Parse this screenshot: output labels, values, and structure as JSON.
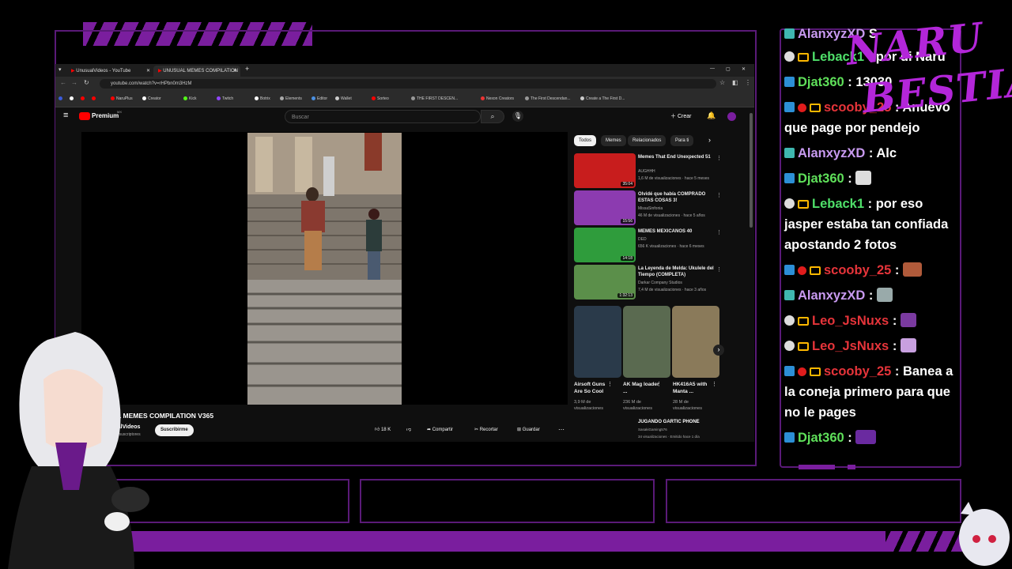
{
  "browser": {
    "tabs": [
      {
        "label": "UnusualVideos - YouTube"
      },
      {
        "label": "UNUSUAL MEMES COMPILATION"
      }
    ],
    "new_tab": "+",
    "url": "youtube.com/watch?v=rHPbn0m3HzM",
    "bookmarks": [
      "NaruPlus",
      "Creator",
      "Kick",
      "Twitch",
      "Botrix",
      "Elements",
      "Editor",
      "Wallet",
      "Sorteo",
      "THE FIRST DESCEN...",
      "Nexon Creators",
      "The First Descendan...",
      "Create a The First D..."
    ]
  },
  "youtube": {
    "logo_text": "Premium",
    "logo_sup": "MX",
    "search_placeholder": "Buscar",
    "create_label": "Crear",
    "video_title": "USUAL MEMES COMPILATION V365",
    "channel_name": "UnusualVideos",
    "subscribers": "3,71 M de suscriptores",
    "subscribe_label": "Suscribirme",
    "likes": "18 K",
    "share_label": "Compartir",
    "clip_label": "Recortar",
    "save_label": "Guardar",
    "chips": [
      "Todos",
      "Memes",
      "Relacionados",
      "Para ti"
    ],
    "recommendations": [
      {
        "title": "Memes That End Unexpected 51",
        "channel": "AUGHHH",
        "stats": "1,6 M de visualizaciones · hace 5 meses",
        "duration": "35:04",
        "color": "#c81d1d"
      },
      {
        "title": "Olvidé que había COMPRADO ESTAS COSAS 3!",
        "channel": "MissaSinfonia",
        "stats": "46 M de visualizaciones · hace 5 años",
        "duration": "15:56",
        "color": "#8c3bb0"
      },
      {
        "title": "MEMES MEXICANOS 40",
        "channel": "DED",
        "stats": "656 K visualizaciones · hace 6 meses",
        "duration": "14:18",
        "color": "#2f9c3c"
      },
      {
        "title": "La Leyenda de Melda: Ukulele del Tiempo (COMPLETA)",
        "channel": "Darkar Company Studios",
        "stats": "7,4 M de visualizaciones · hace 3 años",
        "duration": "1:32:13",
        "color": "#5b8f4a"
      }
    ],
    "shorts": [
      {
        "title": "Airsoft Guns Are So Cool",
        "stats": "3,9 M de visualizaciones"
      },
      {
        "title": "AK Mag loader ...",
        "stats": "236 M de visualizaciones"
      },
      {
        "title": "HK416A5 with Manta ...",
        "stats": "28 M de visualizaciones"
      }
    ],
    "next_title": "JUGANDO GARTIC PHONE",
    "next_channel": "SasakiGaming576",
    "next_stats": "34 visualizaciones · Emitido hace 1 día"
  },
  "chat": {
    "messages": [
      {
        "user": "AlanxyzXD",
        "text": "S",
        "color": "#c89af0",
        "badges": [
          "teal"
        ]
      },
      {
        "user": "Leback1",
        "text": ": por di Naru",
        "color": "#4fe06a",
        "badges": [
          "white",
          "crown"
        ]
      },
      {
        "user": "Djat360",
        "text": ": 13030",
        "color": "#5fe05a",
        "badges": [
          "blue"
        ]
      },
      {
        "user": "scooby_25",
        "text": ": Anuevo que page por pendejo",
        "color": "#e6343a",
        "badges": [
          "blue",
          "red",
          "crown"
        ]
      },
      {
        "user": "AlanxyzXD",
        "text": ": Alc",
        "color": "#c89af0",
        "badges": [
          "teal"
        ]
      },
      {
        "user": "Djat360",
        "text": ":",
        "color": "#5fe05a",
        "badges": [
          "blue"
        ],
        "emote": "#ddd"
      },
      {
        "user": "Leback1",
        "text": ": por eso jasper estaba tan confiada apostando 2 fotos",
        "color": "#4fe06a",
        "badges": [
          "white",
          "crown"
        ]
      },
      {
        "user": "scooby_25",
        "text": ":",
        "color": "#e6343a",
        "badges": [
          "blue",
          "red",
          "crown"
        ],
        "emote": "#b05a3a"
      },
      {
        "user": "AlanxyzXD",
        "text": ":",
        "color": "#c89af0",
        "badges": [
          "teal"
        ],
        "emote": "#9aa"
      },
      {
        "user": "Leo_JsNuxs",
        "text": ":",
        "color": "#e6343a",
        "badges": [
          "white",
          "crown"
        ],
        "emote": "#7a3aa0"
      },
      {
        "user": "Leo_JsNuxs",
        "text": ":",
        "color": "#e6343a",
        "badges": [
          "white",
          "crown"
        ],
        "emote": "#c8a0e0"
      },
      {
        "user": "scooby_25",
        "text": ": Banea a la coneja primero para que no le pages",
        "color": "#e6343a",
        "badges": [
          "blue",
          "red",
          "crown"
        ]
      },
      {
        "user": "Djat360",
        "text": ":",
        "color": "#5fe05a",
        "badges": [
          "blue"
        ],
        "emote": "#6a2aa0"
      }
    ]
  },
  "overlay": {
    "logo_line1": "NARU",
    "logo_line2": "BESTIA",
    "accent_color": "#7a1e9e"
  }
}
